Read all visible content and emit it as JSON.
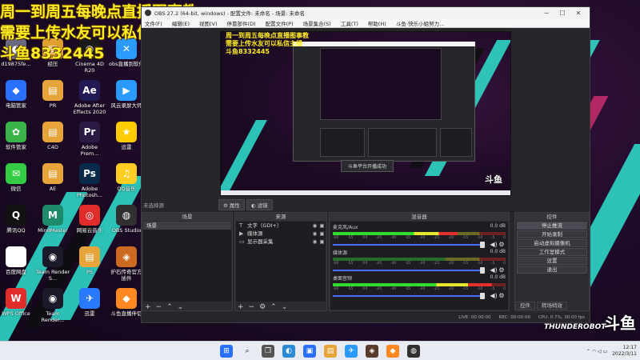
{
  "overlay": {
    "line1": "周一到周五每晚点直播图事教",
    "line2": "需要上传水友可以私信主播",
    "line3": "斗鱼8332445"
  },
  "desktop_icons": [
    {
      "label": "d19875fe...",
      "color": "#6a6a80",
      "glyph": "◐"
    },
    {
      "label": "经压",
      "color": "#e0a030",
      "glyph": "▤"
    },
    {
      "label": "Cinema 4D R20",
      "color": "#1a1a1a",
      "glyph": "◉"
    },
    {
      "label": "obs直播到软件",
      "color": "#2a9aff",
      "glyph": "✕"
    },
    {
      "label": "电脑管家",
      "color": "#2a70ff",
      "glyph": "◆"
    },
    {
      "label": "PR",
      "color": "#e6a43a",
      "glyph": "▤"
    },
    {
      "label": "Adobe After Effects 2020",
      "color": "#221a55",
      "glyph": "Ae"
    },
    {
      "label": "风云录屏大师",
      "color": "#2a9aff",
      "glyph": "▶"
    },
    {
      "label": "软件管家",
      "color": "#3ab34a",
      "glyph": "✿"
    },
    {
      "label": "C4D",
      "color": "#e6a43a",
      "glyph": "▤"
    },
    {
      "label": "Adobe Prem...",
      "color": "#2a1a44",
      "glyph": "Pr"
    },
    {
      "label": "迅雷",
      "color": "#ffcc00",
      "glyph": "★"
    },
    {
      "label": "微信",
      "color": "#33cc44",
      "glyph": "✉"
    },
    {
      "label": "AE",
      "color": "#e6a43a",
      "glyph": "▤"
    },
    {
      "label": "Adobe Photosh...",
      "color": "#0a2a4a",
      "glyph": "Ps"
    },
    {
      "label": "QQ音乐",
      "color": "#ffcc22",
      "glyph": "♫"
    },
    {
      "label": "腾讯QQ",
      "color": "#111111",
      "glyph": "Q"
    },
    {
      "label": "MindMaster",
      "color": "#1f8a6a",
      "glyph": "M"
    },
    {
      "label": "网易云音乐",
      "color": "#e22b2b",
      "glyph": "◎"
    },
    {
      "label": "OBS Studio",
      "color": "#303030",
      "glyph": "◍"
    },
    {
      "label": "百度网盘",
      "color": "#ffffff",
      "glyph": "☁"
    },
    {
      "label": "Team Render S...",
      "color": "#1a1a2a",
      "glyph": "◉"
    },
    {
      "label": "PS",
      "color": "#e6a43a",
      "glyph": "▤"
    },
    {
      "label": "护石传奇官方插件",
      "color": "#cc6a22",
      "glyph": "◈"
    },
    {
      "label": "WPS Office",
      "color": "#e22b2b",
      "glyph": "W"
    },
    {
      "label": "Team Render...",
      "color": "#1a1a2a",
      "glyph": "◉"
    },
    {
      "label": "迅雷",
      "color": "#2a7aff",
      "glyph": "✈"
    },
    {
      "label": "斗鱼直播伴侣",
      "color": "#ff8822",
      "glyph": "◆"
    }
  ],
  "obs": {
    "title": "OBS 27.2 (64-bit, windows) - 配置文件: 未命名 - 场景: 未命名",
    "menu": [
      "文件(F)",
      "编辑(E)",
      "视图(V)",
      "停靠部件(D)",
      "配置文件(P)",
      "场景集合(S)",
      "工具(T)",
      "帮助(H)",
      "斗鱼-快乐小姐努力..."
    ],
    "no_source": "未选择源",
    "btn_properties": "属性",
    "btn_filters": "滤镜",
    "scenes": {
      "title": "场景",
      "items": [
        "场景"
      ]
    },
    "sources": {
      "title": "来源",
      "items": [
        {
          "icon": "T",
          "label": "文字（GDI+）"
        },
        {
          "icon": "▶",
          "label": "媒体源"
        },
        {
          "icon": "▭",
          "label": "显示器采集"
        }
      ]
    },
    "mixer": {
      "title": "混音器",
      "channels": [
        {
          "name": "麦克风/Aux",
          "db": "0.0 dB",
          "level": 0.72
        },
        {
          "name": "媒体源",
          "db": "0.0 dB",
          "level": 0.0
        },
        {
          "name": "桌面音频",
          "db": "0.0 dB",
          "level": 0.92
        }
      ],
      "scale": [
        "-60",
        "-55",
        "-50",
        "-45",
        "-40",
        "-35",
        "-30",
        "-25",
        "-20",
        "-15",
        "-10",
        "-5",
        "0"
      ]
    },
    "controls": {
      "title": "控件",
      "buttons": [
        "停止推流",
        "开始录制",
        "启动虚拟摄像机",
        "工作室模式",
        "设置",
        "退出"
      ]
    },
    "tabs": [
      "控件",
      "转场特效"
    ],
    "status": {
      "live": "LIVE: 00:00:00",
      "rec": "REC: 00:00:00",
      "cpu": "CPU: 0.7%, 30.00 fps"
    },
    "preview_toast": "斗鱼平台开播成功"
  },
  "tray": {
    "time": "12:17",
    "date": "2022/3/11"
  },
  "watermark": {
    "brand": "斗鱼",
    "sub": "THUNDEROBOT"
  },
  "preview_watermark": "斗鱼"
}
